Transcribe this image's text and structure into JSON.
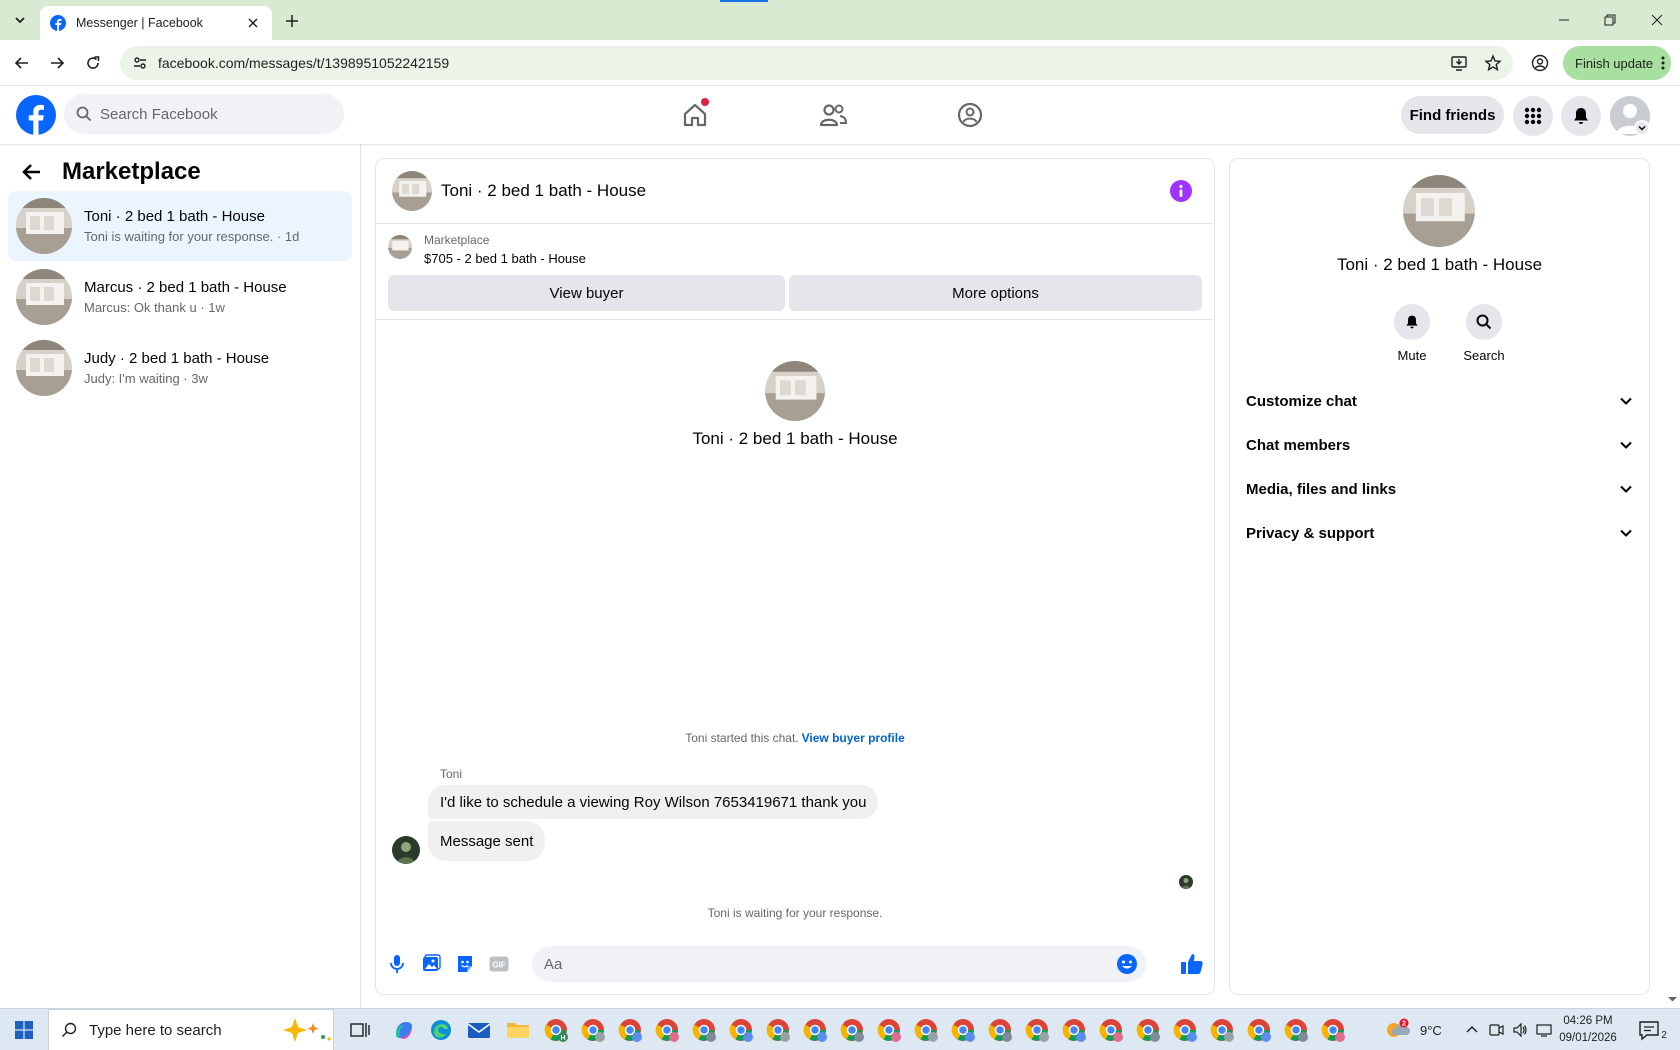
{
  "browser": {
    "tab_title": "Messenger | Facebook",
    "url": "facebook.com/messages/t/1398951052242159",
    "finish_update_label": "Finish update"
  },
  "fb_header": {
    "search_placeholder": "Search Facebook",
    "find_friends_label": "Find friends",
    "brand_color": "#0866ff"
  },
  "sidebar": {
    "title": "Marketplace",
    "conversations": [
      {
        "name": "Toni · 2 bed 1 bath - House",
        "preview": "Toni is waiting for your response. · 1d",
        "active": true
      },
      {
        "name": "Marcus · 2 bed 1 bath - House",
        "preview": "Marcus: Ok thank u · 1w",
        "active": false
      },
      {
        "name": "Judy · 2 bed 1 bath - House",
        "preview": "Judy: I'm waiting · 3w",
        "active": false
      }
    ]
  },
  "chat": {
    "header_name": "Toni · 2 bed 1 bath - House",
    "listing": {
      "label": "Marketplace",
      "price_title": "$705 - 2 bed 1 bath - House",
      "view_buyer_label": "View buyer",
      "more_options_label": "More options"
    },
    "intro_name": "Toni · 2 bed 1 bath - House",
    "started_text": "Toni started this chat.",
    "view_buyer_profile_label": "View buyer profile",
    "sender_name": "Toni",
    "messages": [
      {
        "text": "I'd like to schedule a viewing Roy Wilson 7653419671 thank you"
      },
      {
        "text": "Message sent"
      }
    ],
    "waiting_text": "Toni is waiting for your response.",
    "composer_placeholder": "Aa",
    "accent_color": "#0866ff",
    "info_color": "#a033ff"
  },
  "details": {
    "name": "Toni · 2 bed 1 bath - House",
    "mute_label": "Mute",
    "search_label": "Search",
    "sections": [
      {
        "label": "Customize chat"
      },
      {
        "label": "Chat members"
      },
      {
        "label": "Media, files and links"
      },
      {
        "label": "Privacy & support"
      }
    ]
  },
  "taskbar": {
    "search_placeholder": "Type here to search",
    "weather": "9°C",
    "weather_badge": "2",
    "time": "04:26 PM",
    "date": "09/01/2026",
    "notification_count": "2"
  }
}
